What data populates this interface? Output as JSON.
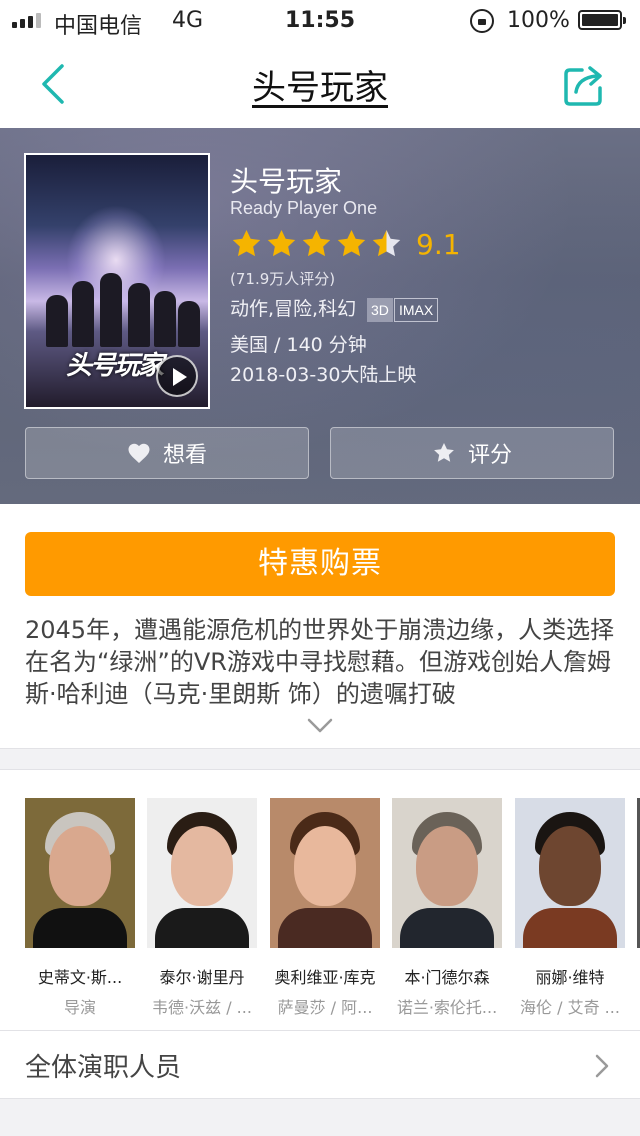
{
  "status_bar": {
    "carrier": "中国电信",
    "network": "4G",
    "time": "11:55",
    "battery": "100%"
  },
  "nav": {
    "title": "头号玩家",
    "back_icon": "chevron-left-icon",
    "share_icon": "share-icon"
  },
  "movie": {
    "title": "头号玩家",
    "english_title": "Ready Player One",
    "rating": "9.1",
    "rating_stars": 4.5,
    "rating_count": "(71.9万人评分)",
    "genres": "动作,冒险,科幻",
    "tag_3d": "3D",
    "tag_imax": "IMAX",
    "region_duration": "美国 / 140 分钟",
    "release": "2018-03-30大陆上映",
    "poster_logo": "头号玩家"
  },
  "actions": {
    "want_label": "想看",
    "rate_label": "评分",
    "ticket_label": "特惠购票"
  },
  "synopsis": "2045年，遭遇能源危机的世界处于崩溃边缘，人类选择在名为“绿洲”的VR游戏中寻找慰藉。但游戏创始人詹姆斯·哈利迪（马克·里朗斯 饰）的遗嘱打破",
  "cast": [
    {
      "name": "史蒂文·斯...",
      "role": "导演"
    },
    {
      "name": "泰尔·谢里丹",
      "role": "韦德·沃兹 / ..."
    },
    {
      "name": "奥利维亚·库克",
      "role": "萨曼莎 / 阿..."
    },
    {
      "name": "本·门德尔森",
      "role": "诺兰·索伦托..."
    },
    {
      "name": "丽娜·维特",
      "role": "海伦 / 艾奇 ..."
    }
  ],
  "all_cast_label": "全体演职人员",
  "colors": {
    "accent": "#ff9a00",
    "star": "#f5b400",
    "nav_icon": "#1fb8b0"
  }
}
